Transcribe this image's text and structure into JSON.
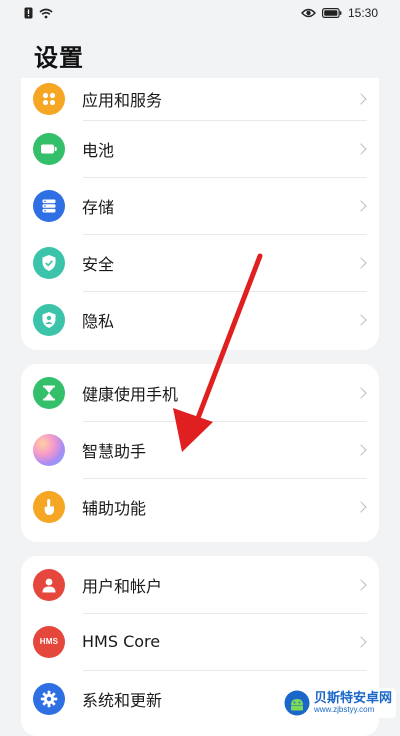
{
  "status_bar": {
    "time": "15:30",
    "left_icons": [
      "alert-icon",
      "wifi-icon"
    ],
    "right_icons": [
      "eye-icon",
      "battery-icon"
    ]
  },
  "page": {
    "title": "设置"
  },
  "groups": [
    {
      "items": [
        {
          "label": "应用和服务",
          "icon": "apps-icon",
          "color": "#f5a623"
        },
        {
          "label": "电池",
          "icon": "battery-icon",
          "color": "#34c06a"
        },
        {
          "label": "存储",
          "icon": "storage-icon",
          "color": "#2f6fe4"
        },
        {
          "label": "安全",
          "icon": "shield-icon",
          "color": "#3cc4ab"
        },
        {
          "label": "隐私",
          "icon": "privacy-icon",
          "color": "#3cc4ab"
        }
      ]
    },
    {
      "items": [
        {
          "label": "健康使用手机",
          "icon": "hourglass-icon",
          "color": "#34c06a"
        },
        {
          "label": "智慧助手",
          "icon": "smart-assistant-icon",
          "color": "#b28cf0"
        },
        {
          "label": "辅助功能",
          "icon": "accessibility-icon",
          "color": "#f5a623"
        }
      ]
    },
    {
      "items": [
        {
          "label": "用户和帐户",
          "icon": "user-icon",
          "color": "#e5473c"
        },
        {
          "label": "HMS Core",
          "icon": "hms-icon",
          "color": "#e5473c",
          "icon_text": "HMS"
        },
        {
          "label": "系统和更新",
          "icon": "gear-icon",
          "color": "#2f6fe4"
        }
      ]
    }
  ],
  "annotation": {
    "arrow_color": "#e02020"
  },
  "watermark": {
    "title": "贝斯特安卓网",
    "url": "www.zjbstyy.com"
  }
}
